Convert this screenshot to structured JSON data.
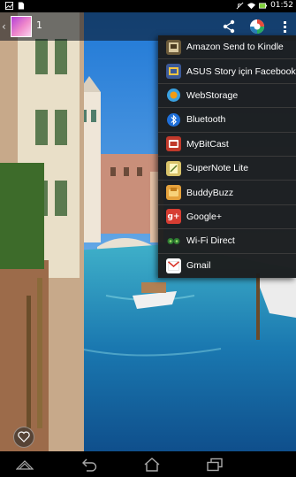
{
  "status_bar": {
    "time": "01:52",
    "icons": [
      "image-notification-icon",
      "file-notification-icon",
      "mute-icon",
      "wifi-icon",
      "battery-icon"
    ]
  },
  "action_bar": {
    "album_count": "1",
    "buttons": [
      "share-icon",
      "app-switch-icon",
      "overflow-menu-icon"
    ]
  },
  "share_menu": {
    "items": [
      {
        "label": "Amazon Send to Kindle",
        "icon": "kindle-icon",
        "color": "#6b5a3a"
      },
      {
        "label": "ASUS Story için Facebook",
        "icon": "asus-story-icon",
        "color": "#3b5998"
      },
      {
        "label": "WebStorage",
        "icon": "webstorage-icon",
        "color": "#f39c12"
      },
      {
        "label": "Bluetooth",
        "icon": "bluetooth-icon",
        "color": "#1e6fd9"
      },
      {
        "label": "MyBitCast",
        "icon": "mybitcast-icon",
        "color": "#c0392b"
      },
      {
        "label": "SuperNote Lite",
        "icon": "supernote-icon",
        "color": "#d9c36a"
      },
      {
        "label": "BuddyBuzz",
        "icon": "buddybuzz-icon",
        "color": "#e6a23c"
      },
      {
        "label": "Google+",
        "icon": "google-plus-icon",
        "color": "#d73d32"
      },
      {
        "label": "Wi-Fi Direct",
        "icon": "wifi-direct-icon",
        "color": "#2e7d32"
      },
      {
        "label": "Gmail",
        "icon": "gmail-icon",
        "color": "#ffffff"
      }
    ]
  },
  "nav_bar": {
    "buttons": [
      "menu-icon",
      "back-icon",
      "home-icon",
      "recent-apps-icon"
    ]
  }
}
